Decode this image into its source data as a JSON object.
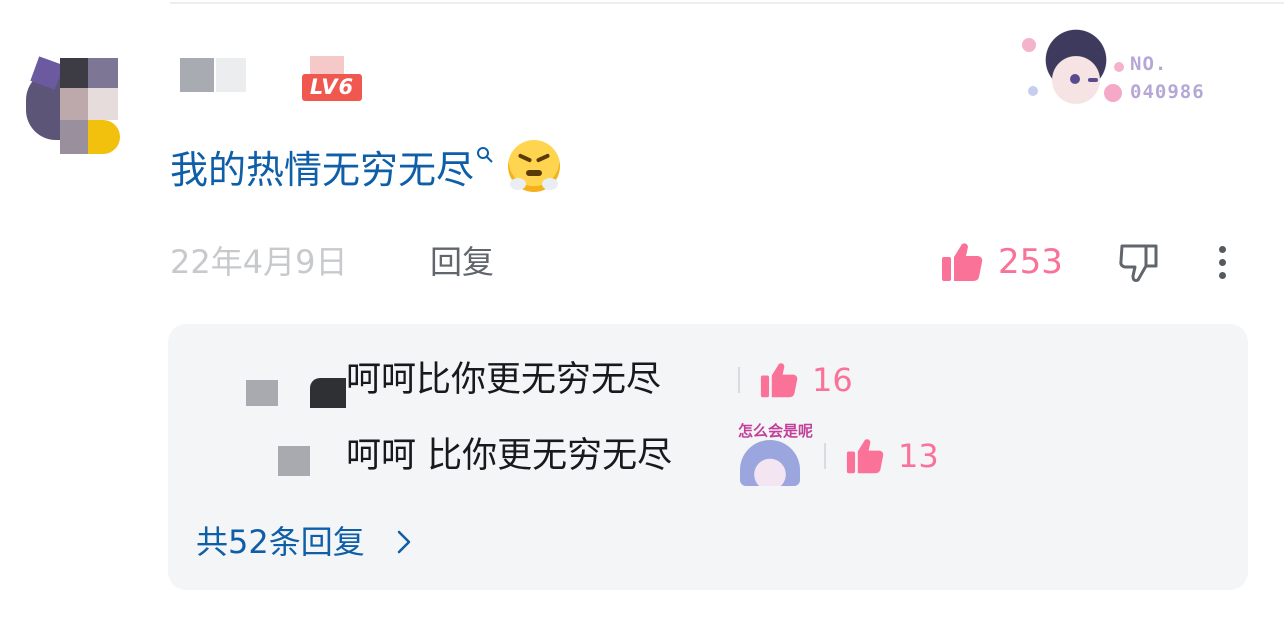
{
  "comment": {
    "level_badge": "LV6",
    "text": "我的热情无穷无尽",
    "date": "22年4月9日",
    "reply_label": "回复",
    "like_count": "253",
    "accent_color": "#fb7299",
    "link_color": "#0f5ea8"
  },
  "fan_medal": {
    "label": "NO.",
    "number": "040986"
  },
  "replies": [
    {
      "text": "呵呵比你更无穷无尽",
      "like_count": "16"
    },
    {
      "text": "呵呵 比你更无穷无尽",
      "like_count": "13",
      "sticker_text": "怎么会是呢"
    }
  ],
  "more_replies_label": "共52条回复",
  "icons": {
    "like": "thumbs-up-icon",
    "dislike": "thumbs-down-icon",
    "more": "more-vertical-icon",
    "chevron": "chevron-right-icon",
    "search": "search-icon"
  }
}
